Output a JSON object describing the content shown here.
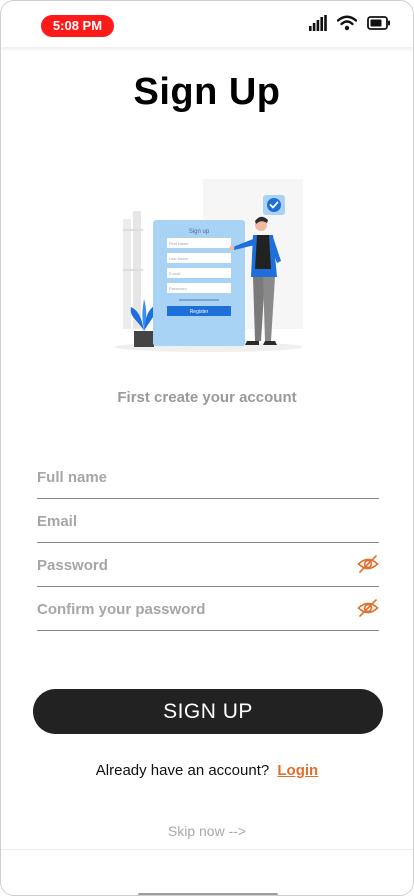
{
  "status_bar": {
    "time": "5:08 PM",
    "icons": [
      "cellular-signal-icon",
      "wifi-icon",
      "battery-icon"
    ]
  },
  "title": "Sign Up",
  "illustration": {
    "icon": "signup-illustration-icon",
    "card_title": "Sign up",
    "card_fields": [
      "First Name",
      "Last Name",
      "E-mail",
      "Password"
    ],
    "card_button": "Register"
  },
  "subtitle": "First create your account",
  "form": {
    "full_name": {
      "placeholder": "Full name",
      "value": ""
    },
    "email": {
      "placeholder": "Email",
      "value": ""
    },
    "password": {
      "placeholder": "Password",
      "value": "",
      "icon": "eye-off-icon"
    },
    "confirm_password": {
      "placeholder": "Confirm your password",
      "value": "",
      "icon": "eye-off-icon"
    }
  },
  "signup_button": "SIGN UP",
  "login_prompt": {
    "text": "Already have an account?",
    "link": "Login"
  },
  "skip": "Skip now -->",
  "colors": {
    "accent": "#e0702e",
    "button": "#222222",
    "time_pill": "#ff1a1a",
    "placeholder": "#a6a6a6"
  }
}
